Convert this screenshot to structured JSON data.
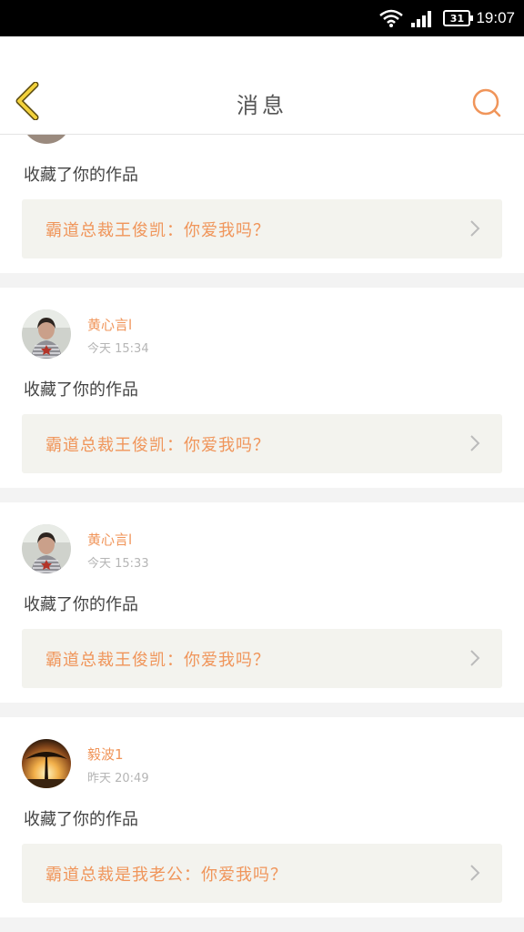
{
  "status_bar": {
    "battery_level": "31",
    "time": "19:07"
  },
  "header": {
    "title": "消息",
    "back_icon": "chevron-left-icon",
    "search_icon": "search-icon"
  },
  "accent_color": "#f0955a",
  "notifications": [
    {
      "username": "",
      "timestamp": "",
      "action": "收藏了你的作品",
      "work_title": "霸道总裁王俊凯：你爱我吗？"
    },
    {
      "username": "黄心言l",
      "timestamp": "今天 15:34",
      "action": "收藏了你的作品",
      "work_title": "霸道总裁王俊凯：你爱我吗？"
    },
    {
      "username": "黄心言l",
      "timestamp": "今天 15:33",
      "action": "收藏了你的作品",
      "work_title": "霸道总裁王俊凯：你爱我吗？"
    },
    {
      "username": "毅波1",
      "timestamp": "昨天 20:49",
      "action": "收藏了你的作品",
      "work_title": "霸道总裁是我老公：你爱我吗？"
    }
  ]
}
